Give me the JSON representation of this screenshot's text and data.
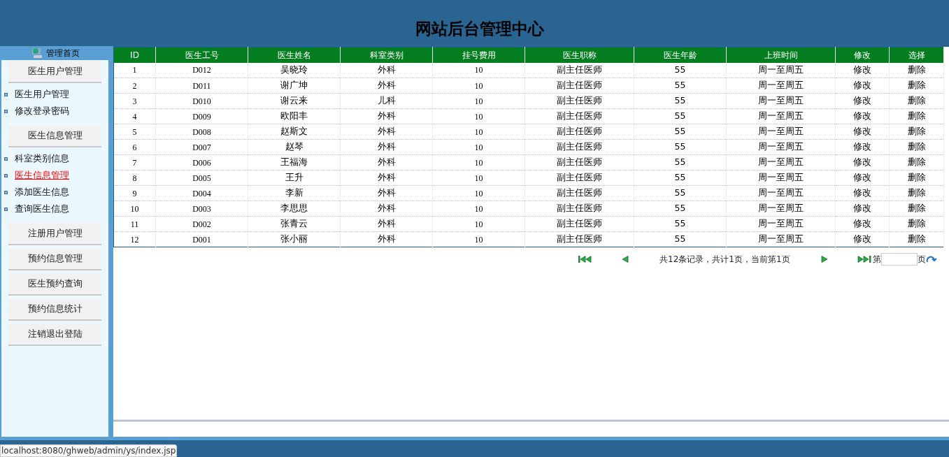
{
  "header": {
    "title": "网站后台管理中心"
  },
  "sidebar": {
    "home": "管理首页",
    "sections": [
      {
        "title": "医生用户管理",
        "items": [
          {
            "label": "医生用户管理",
            "selected": false
          },
          {
            "label": "修改登录密码",
            "selected": false
          }
        ]
      },
      {
        "title": "医生信息管理",
        "items": [
          {
            "label": "科室类别信息",
            "selected": false
          },
          {
            "label": "医生信息管理",
            "selected": true
          },
          {
            "label": "添加医生信息",
            "selected": false
          },
          {
            "label": "查询医生信息",
            "selected": false
          }
        ]
      },
      {
        "title": "注册用户管理"
      },
      {
        "title": "预约信息管理"
      },
      {
        "title": "医生预约查询"
      },
      {
        "title": "预约信息统计"
      },
      {
        "title": "注销退出登陆"
      }
    ]
  },
  "table": {
    "columns": [
      "ID",
      "医生工号",
      "医生姓名",
      "科室类别",
      "挂号费用",
      "医生职称",
      "医生年龄",
      "上班时间",
      "修改",
      "选择"
    ],
    "rows": [
      [
        "1",
        "D012",
        "吴晓玲",
        "外科",
        "10",
        "副主任医师",
        "55",
        "周一至周五",
        "修改",
        "删除"
      ],
      [
        "2",
        "D011",
        "谢广坤",
        "外科",
        "10",
        "副主任医师",
        "55",
        "周一至周五",
        "修改",
        "删除"
      ],
      [
        "3",
        "D010",
        "谢云来",
        "儿科",
        "10",
        "副主任医师",
        "55",
        "周一至周五",
        "修改",
        "删除"
      ],
      [
        "4",
        "D009",
        "欧阳丰",
        "外科",
        "10",
        "副主任医师",
        "55",
        "周一至周五",
        "修改",
        "删除"
      ],
      [
        "5",
        "D008",
        "赵斯文",
        "外科",
        "10",
        "副主任医师",
        "55",
        "周一至周五",
        "修改",
        "删除"
      ],
      [
        "6",
        "D007",
        "赵琴",
        "外科",
        "10",
        "副主任医师",
        "55",
        "周一至周五",
        "修改",
        "删除"
      ],
      [
        "7",
        "D006",
        "王福海",
        "外科",
        "10",
        "副主任医师",
        "55",
        "周一至周五",
        "修改",
        "删除"
      ],
      [
        "8",
        "D005",
        "王升",
        "外科",
        "10",
        "副主任医师",
        "55",
        "周一至周五",
        "修改",
        "删除"
      ],
      [
        "9",
        "D004",
        "李新",
        "外科",
        "10",
        "副主任医师",
        "55",
        "周一至周五",
        "修改",
        "删除"
      ],
      [
        "10",
        "D003",
        "李思思",
        "外科",
        "10",
        "副主任医师",
        "55",
        "周一至周五",
        "修改",
        "删除"
      ],
      [
        "11",
        "D002",
        "张青云",
        "外科",
        "10",
        "副主任医师",
        "55",
        "周一至周五",
        "修改",
        "删除"
      ],
      [
        "12",
        "D001",
        "张小丽",
        "外科",
        "10",
        "副主任医师",
        "55",
        "周一至周五",
        "修改",
        "删除"
      ]
    ]
  },
  "pagination": {
    "summary": "共12条记录，共计1页，当前第1页",
    "page_prefix": "第",
    "page_suffix": "页"
  },
  "status_bar": {
    "url": "localhost:8080/ghweb/admin/ys/index.jsp"
  }
}
